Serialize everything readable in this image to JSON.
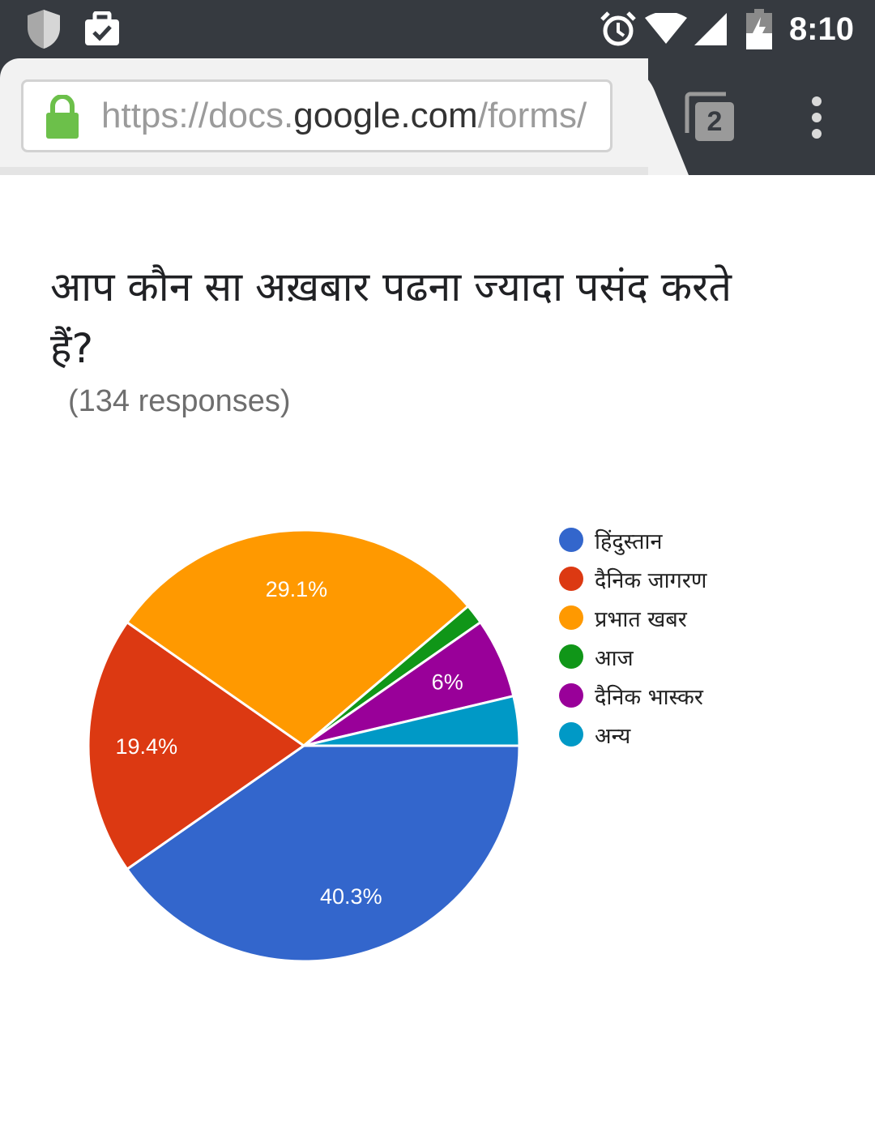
{
  "status_bar": {
    "time": "8:10",
    "icons": [
      "shield-icon",
      "briefcase-check-icon",
      "alarm-icon",
      "wifi-icon",
      "signal-icon",
      "battery-charging-icon"
    ]
  },
  "browser": {
    "url_prefix": "https://docs.",
    "url_domain": "google.com",
    "url_suffix": "/forms/",
    "tab_count": "2",
    "lock_color": "#6cc04a"
  },
  "form": {
    "question": "आप कौन सा अख़बार पढना ज्यादा पसंद करते हैं?",
    "responses": "(134 responses)"
  },
  "chart_data": {
    "type": "pie",
    "title": "",
    "categories": [
      "हिंदुस्तान",
      "दैनिक जागरण",
      "प्रभात खबर",
      "आज",
      "दैनिक भास्कर",
      "अन्य"
    ],
    "values": [
      40.3,
      19.4,
      29.1,
      1.5,
      6.0,
      3.7
    ],
    "labels": [
      "40.3%",
      "19.4%",
      "29.1%",
      "",
      "6%",
      ""
    ],
    "colors": [
      "#3366cc",
      "#dc3912",
      "#ff9900",
      "#109618",
      "#990099",
      "#0099c6"
    ],
    "legend": "right"
  }
}
